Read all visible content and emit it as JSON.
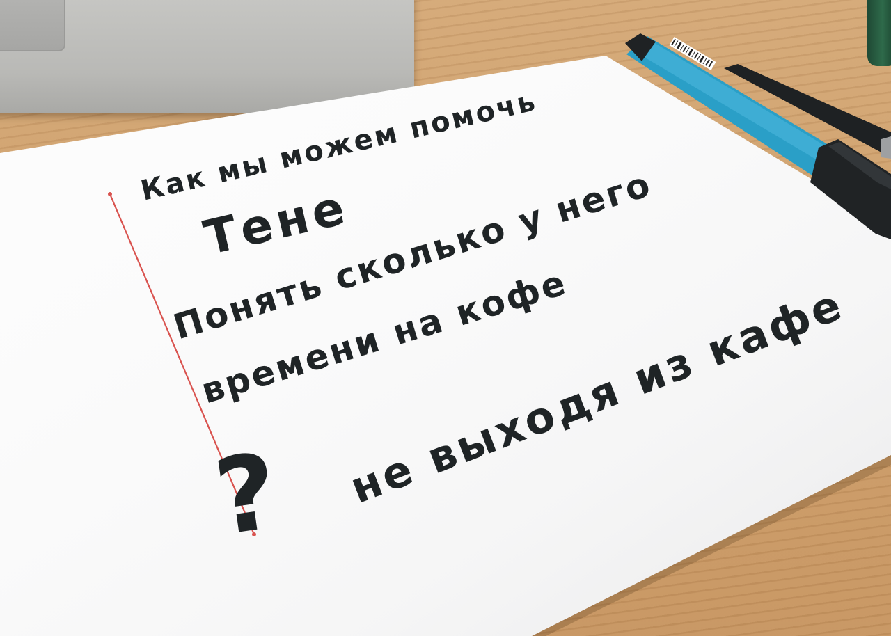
{
  "note": {
    "line_1": "Как мы можем помочь",
    "line_2": "Тене",
    "line_3": "Понять сколько у него",
    "line_4": "времени на кофе",
    "line_5": "не выходя из кафе",
    "question_mark": "?"
  },
  "colors": {
    "desk": "#c99b66",
    "paper": "#fdfdfd",
    "ink": "#1f2426",
    "margin_line": "#d9534f",
    "marker_barrel": "#2a9fc7",
    "marker_cap": "#202325",
    "laptop": "#bdbdbb"
  },
  "icons": {
    "laptop": "laptop-icon",
    "marker": "marker-pen-icon",
    "pen": "pen-icon"
  }
}
